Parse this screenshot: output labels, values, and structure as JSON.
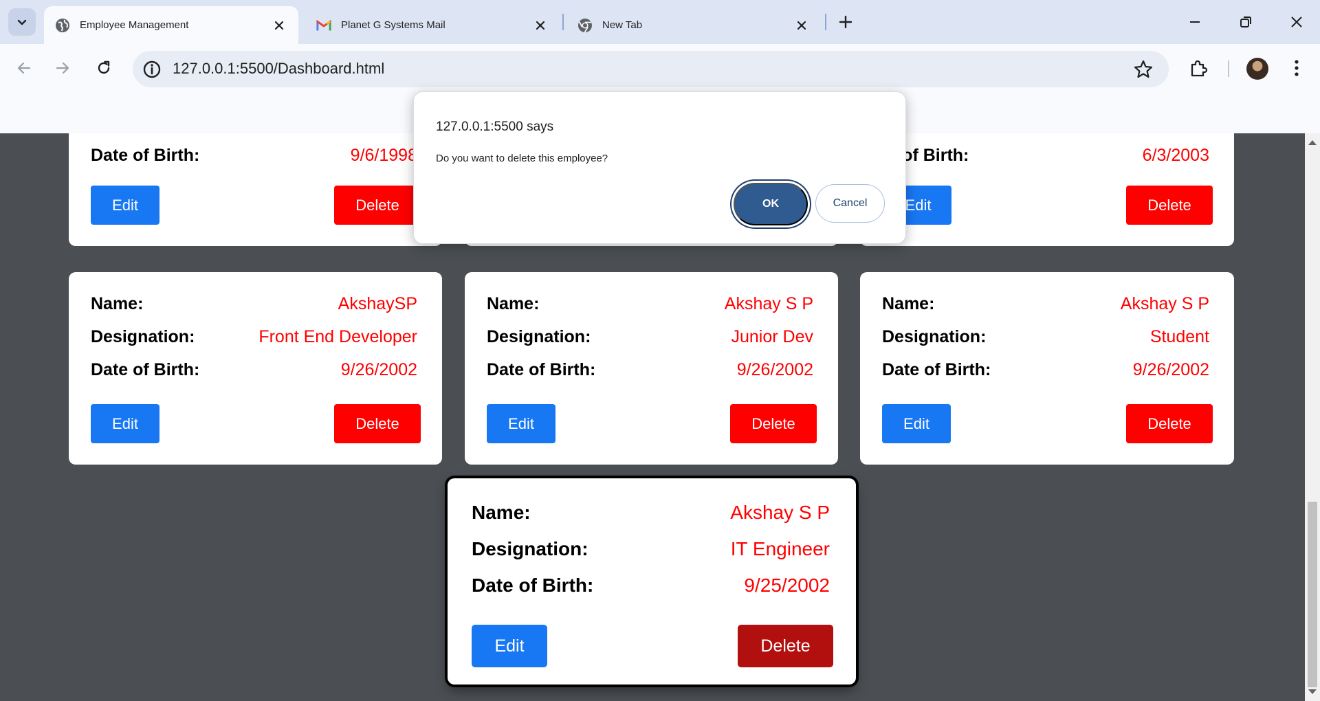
{
  "tabs": [
    {
      "title": "Employee Management",
      "active": true,
      "icon": "globe-icon"
    },
    {
      "title": "Planet G Systems Mail",
      "active": false,
      "icon": "gmail-icon"
    },
    {
      "title": "New Tab",
      "active": false,
      "icon": "chrome-icon"
    }
  ],
  "address": {
    "url": "127.0.0.1:5500/Dashboard.html"
  },
  "dialog": {
    "title": "127.0.0.1:5500 says",
    "message": "Do you want to delete this employee?",
    "ok_label": "OK",
    "cancel_label": "Cancel"
  },
  "labels": {
    "name": "Name:",
    "designation": "Designation:",
    "dob": "Date of Birth:",
    "dob_partial": "te of Birth:",
    "edit": "Edit",
    "edit_partial": "Edit",
    "delete": "Delete"
  },
  "top_cards": [
    {
      "dob": "9/6/1998"
    },
    {
      "dob": "6/3/2003"
    }
  ],
  "cards": [
    {
      "name": "AkshaySP",
      "designation": "Front End Developer",
      "dob": "9/26/2002"
    },
    {
      "name": "Akshay S P",
      "designation": "Junior Dev",
      "dob": "9/26/2002"
    },
    {
      "name": "Akshay S P",
      "designation": "Student",
      "dob": "9/26/2002"
    }
  ],
  "focused_card": {
    "name": "Akshay S P",
    "designation": "IT Engineer",
    "dob": "9/25/2002"
  },
  "colors": {
    "value_red": "#ff0000",
    "edit_blue": "#1877f2",
    "delete_red": "#ff0000",
    "delete_hover": "#b20f0f",
    "page_bg": "#4b4f53"
  }
}
